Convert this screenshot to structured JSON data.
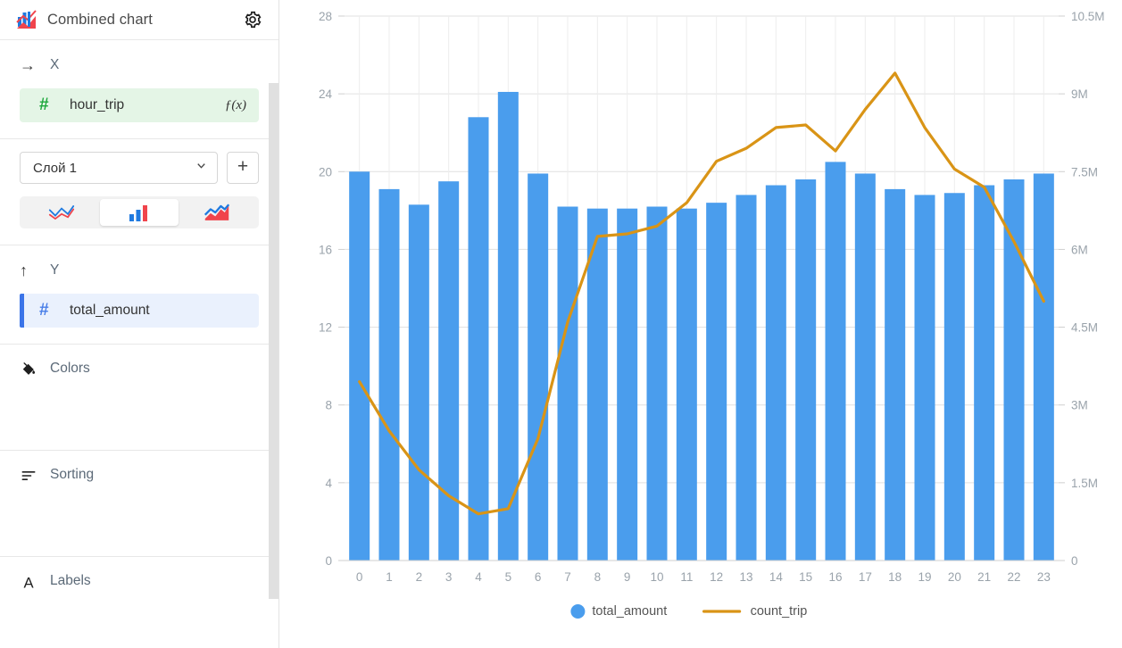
{
  "header": {
    "title": "Combined chart",
    "logo_icon": "combined-chart-icon",
    "settings_icon": "gear-icon"
  },
  "sidebar": {
    "x_section": {
      "icon": "arrow-right-icon",
      "label": "X",
      "field": {
        "name": "hour_trip",
        "type_icon": "hash-icon",
        "formula_icon": "fx-icon",
        "formula_label": "ƒ(x)"
      }
    },
    "layer_section": {
      "select_value": "Слой 1",
      "chevron_icon": "chevron-down-icon",
      "add_label": "+",
      "chart_types": [
        {
          "name": "line-chart-icon",
          "active": false
        },
        {
          "name": "bar-chart-icon",
          "active": true
        },
        {
          "name": "area-chart-icon",
          "active": false
        }
      ]
    },
    "y_section": {
      "icon": "arrow-up-icon",
      "label": "Y",
      "field": {
        "name": "total_amount",
        "type_icon": "hash-icon"
      }
    },
    "colors": {
      "label": "Colors",
      "icon": "paint-bucket-icon"
    },
    "sorting": {
      "label": "Sorting",
      "icon": "sort-icon"
    },
    "labels": {
      "label": "Labels",
      "icon": "text-a-icon"
    }
  },
  "chart_data": {
    "type": "bar",
    "title": "",
    "xlabel": "",
    "ylabel": "",
    "grid": true,
    "legend_position": "bottom",
    "categories": [
      "0",
      "1",
      "2",
      "3",
      "4",
      "5",
      "6",
      "7",
      "8",
      "9",
      "10",
      "11",
      "12",
      "13",
      "14",
      "15",
      "16",
      "17",
      "18",
      "19",
      "20",
      "21",
      "22",
      "23"
    ],
    "left_axis": {
      "ticks": [
        "0",
        "4",
        "8",
        "12",
        "16",
        "20",
        "24",
        "28"
      ],
      "values": [
        0,
        4,
        8,
        12,
        16,
        20,
        24,
        28
      ],
      "ylim": [
        0,
        28
      ]
    },
    "right_axis": {
      "ticks": [
        "0",
        "1.5M",
        "3M",
        "4.5M",
        "6M",
        "7.5M",
        "9M",
        "10.5M"
      ],
      "values": [
        0,
        1500000,
        3000000,
        4500000,
        6000000,
        7500000,
        9000000,
        10500000
      ],
      "ylim": [
        0,
        10500000
      ]
    },
    "series": [
      {
        "name": "total_amount",
        "type": "bar",
        "axis": "left",
        "color": "#4a9ded",
        "values": [
          20.0,
          19.1,
          18.3,
          19.5,
          22.8,
          24.1,
          19.9,
          18.2,
          18.1,
          18.1,
          18.2,
          18.1,
          18.4,
          18.8,
          19.3,
          19.6,
          20.5,
          19.9,
          19.1,
          18.8,
          18.9,
          19.3,
          19.6,
          19.9
        ]
      },
      {
        "name": "count_trip",
        "type": "line",
        "axis": "right",
        "color": "#d99416",
        "values": [
          3450000,
          2500000,
          1750000,
          1250000,
          900000,
          1000000,
          2350000,
          4600000,
          6250000,
          6300000,
          6450000,
          6900000,
          7700000,
          7950000,
          8350000,
          8400000,
          7900000,
          8700000,
          9400000,
          8350000,
          7550000,
          7200000,
          6150000,
          5000000
        ]
      }
    ],
    "legend": [
      {
        "label": "total_amount",
        "color": "#4a9ded",
        "marker": "circle"
      },
      {
        "label": "count_trip",
        "color": "#d99416",
        "marker": "line"
      }
    ]
  }
}
